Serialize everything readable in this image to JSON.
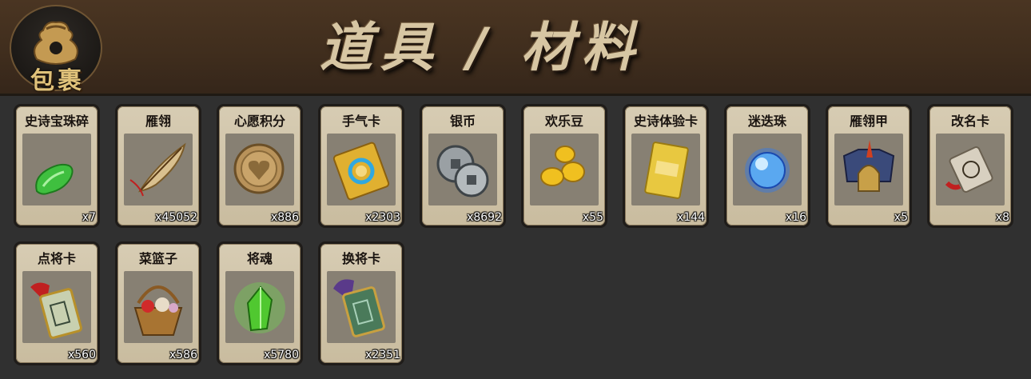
{
  "header": {
    "badge_label": "包裹",
    "title": "道具 / 材料"
  },
  "items": [
    {
      "name": "史诗宝珠碎",
      "count": "x7",
      "icon": "green-gem-fragment-icon"
    },
    {
      "name": "雁翎",
      "count": "x45052",
      "icon": "feather-icon"
    },
    {
      "name": "心愿积分",
      "count": "x886",
      "icon": "heart-coin-icon"
    },
    {
      "name": "手气卡",
      "count": "x2303",
      "icon": "luck-card-icon"
    },
    {
      "name": "银币",
      "count": "x8692",
      "icon": "silver-coins-icon"
    },
    {
      "name": "欢乐豆",
      "count": "x55",
      "icon": "gold-beans-icon"
    },
    {
      "name": "史诗体验卡",
      "count": "x144",
      "icon": "gold-card-icon"
    },
    {
      "name": "迷迭珠",
      "count": "x16",
      "icon": "blue-orb-icon"
    },
    {
      "name": "雁翎甲",
      "count": "x5",
      "icon": "armor-helmet-icon"
    },
    {
      "name": "改名卡",
      "count": "x8",
      "icon": "rename-scroll-icon"
    },
    {
      "name": "点将卡",
      "count": "x560",
      "icon": "general-token-icon"
    },
    {
      "name": "菜篮子",
      "count": "x586",
      "icon": "flower-basket-icon"
    },
    {
      "name": "将魂",
      "count": "x5780",
      "icon": "green-crystal-icon"
    },
    {
      "name": "换将卡",
      "count": "x2351",
      "icon": "swap-general-token-icon"
    }
  ]
}
